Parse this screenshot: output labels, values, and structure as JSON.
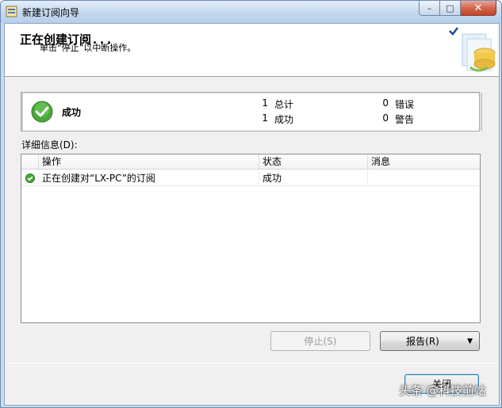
{
  "window": {
    "title": "新建订阅向导",
    "controls": {
      "minimize": "–",
      "maximize": "□",
      "close": "✕"
    }
  },
  "header": {
    "title": "正在创建订阅...",
    "subtitle": "单击“停止”以中断操作。"
  },
  "summary": {
    "status": "成功",
    "stats": [
      {
        "count": "1",
        "label": "总计"
      },
      {
        "count": "0",
        "label": "错误"
      },
      {
        "count": "1",
        "label": "成功"
      },
      {
        "count": "0",
        "label": "警告"
      }
    ]
  },
  "details": {
    "label": "详细信息(D):",
    "columns": [
      "操作",
      "状态",
      "消息"
    ],
    "rows": [
      {
        "icon": "success-icon",
        "action": "正在创建对“LX-PC”的订阅",
        "status": "成功",
        "message": ""
      }
    ]
  },
  "buttons": {
    "stop": "停止(S)",
    "report": "报告(R)",
    "close": "关闭"
  },
  "watermark": "头条 @科技前站",
  "colors": {
    "success_green": "#3a9a2a",
    "accent": "#3c7fb1"
  }
}
